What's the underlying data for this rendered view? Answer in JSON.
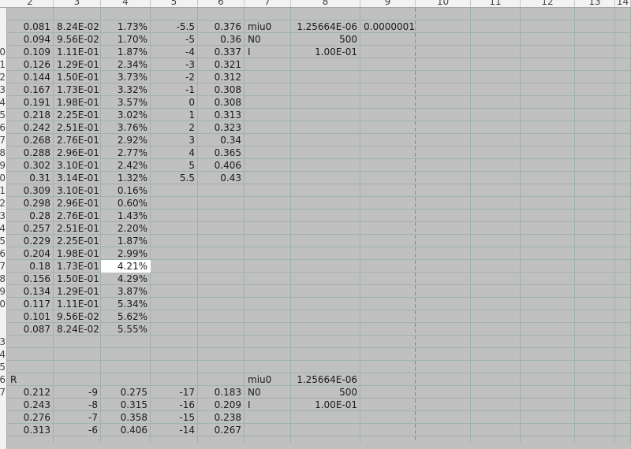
{
  "sheet": {
    "column_headers": [
      "2",
      "3",
      "4",
      "5",
      "6",
      "7",
      "8",
      "9",
      "10",
      "11",
      "12",
      "13",
      "14"
    ],
    "row_labels": [
      "",
      "",
      "0",
      "1",
      "2",
      "3",
      "4",
      "5",
      "6",
      "7",
      "8",
      "9",
      "0",
      "1",
      "2",
      "3",
      "4",
      "5",
      "6",
      "7",
      "8",
      "9",
      "0",
      "",
      "",
      "3",
      "4",
      "5",
      "6",
      "7"
    ],
    "top_block": {
      "col2": [
        "0.081",
        "0.094",
        "0.109",
        "0.126",
        "0.144",
        "0.167",
        "0.191",
        "0.218",
        "0.242",
        "0.268",
        "0.288",
        "0.302",
        "0.31",
        "0.309",
        "0.298",
        "0.28",
        "0.257",
        "0.229",
        "0.204",
        "0.18",
        "0.156",
        "0.134",
        "0.117",
        "0.101",
        "0.087"
      ],
      "col3": [
        "8.24E-02",
        "9.56E-02",
        "1.11E-01",
        "1.29E-01",
        "1.50E-01",
        "1.73E-01",
        "1.98E-01",
        "2.25E-01",
        "2.51E-01",
        "2.76E-01",
        "2.96E-01",
        "3.10E-01",
        "3.14E-01",
        "3.10E-01",
        "2.96E-01",
        "2.76E-01",
        "2.51E-01",
        "2.25E-01",
        "1.98E-01",
        "1.73E-01",
        "1.50E-01",
        "1.29E-01",
        "1.11E-01",
        "9.56E-02",
        "8.24E-02"
      ],
      "col4": [
        "1.73%",
        "1.70%",
        "1.87%",
        "2.34%",
        "3.73%",
        "3.32%",
        "3.57%",
        "3.02%",
        "3.76%",
        "2.92%",
        "2.77%",
        "2.42%",
        "1.32%",
        "0.16%",
        "0.60%",
        "1.43%",
        "2.20%",
        "1.87%",
        "2.99%",
        "4.21%",
        "4.29%",
        "3.87%",
        "5.34%",
        "5.62%",
        "5.55%"
      ],
      "col5": [
        "-5.5",
        "-5",
        "-4",
        "-3",
        "-2",
        "-1",
        "0",
        "1",
        "2",
        "3",
        "4",
        "5",
        "5.5"
      ],
      "col6": [
        "0.376",
        "0.36",
        "0.337",
        "0.321",
        "0.312",
        "0.308",
        "0.308",
        "0.313",
        "0.323",
        "0.34",
        "0.365",
        "0.406",
        "0.43"
      ],
      "params": [
        {
          "label": "miu0",
          "value": "1.25664E-06",
          "extra": "0.0000001"
        },
        {
          "label": "N0",
          "value": "500",
          "extra": ""
        },
        {
          "label": "I",
          "value": "1.00E-01",
          "extra": ""
        }
      ]
    },
    "bottom_block": {
      "r_label": "R",
      "miu0_label": "miu0",
      "miu0_value": "1.25664E-06",
      "rows": [
        {
          "c2": "0.212",
          "c3": "-9",
          "c4": "0.275",
          "c5": "-17",
          "c6": "0.183",
          "c7": "N0",
          "c8": "500"
        },
        {
          "c2": "0.243",
          "c3": "-8",
          "c4": "0.315",
          "c5": "-16",
          "c6": "0.209",
          "c7": "I",
          "c8": "1.00E-01"
        },
        {
          "c2": "0.276",
          "c3": "-7",
          "c4": "0.358",
          "c5": "-15",
          "c6": "0.238",
          "c7": "",
          "c8": ""
        },
        {
          "c2": "0.313",
          "c3": "-6",
          "c4": "0.406",
          "c5": "-14",
          "c6": "0.267",
          "c7": "",
          "c8": ""
        }
      ]
    },
    "selected_cell": {
      "column": "4",
      "row_index": 19
    }
  },
  "colors": {
    "cell_background": "#c0c0c0",
    "gridline": "#9fb3a6",
    "header_background": "#f2f2f2",
    "selected_cell": "#ffffff"
  }
}
